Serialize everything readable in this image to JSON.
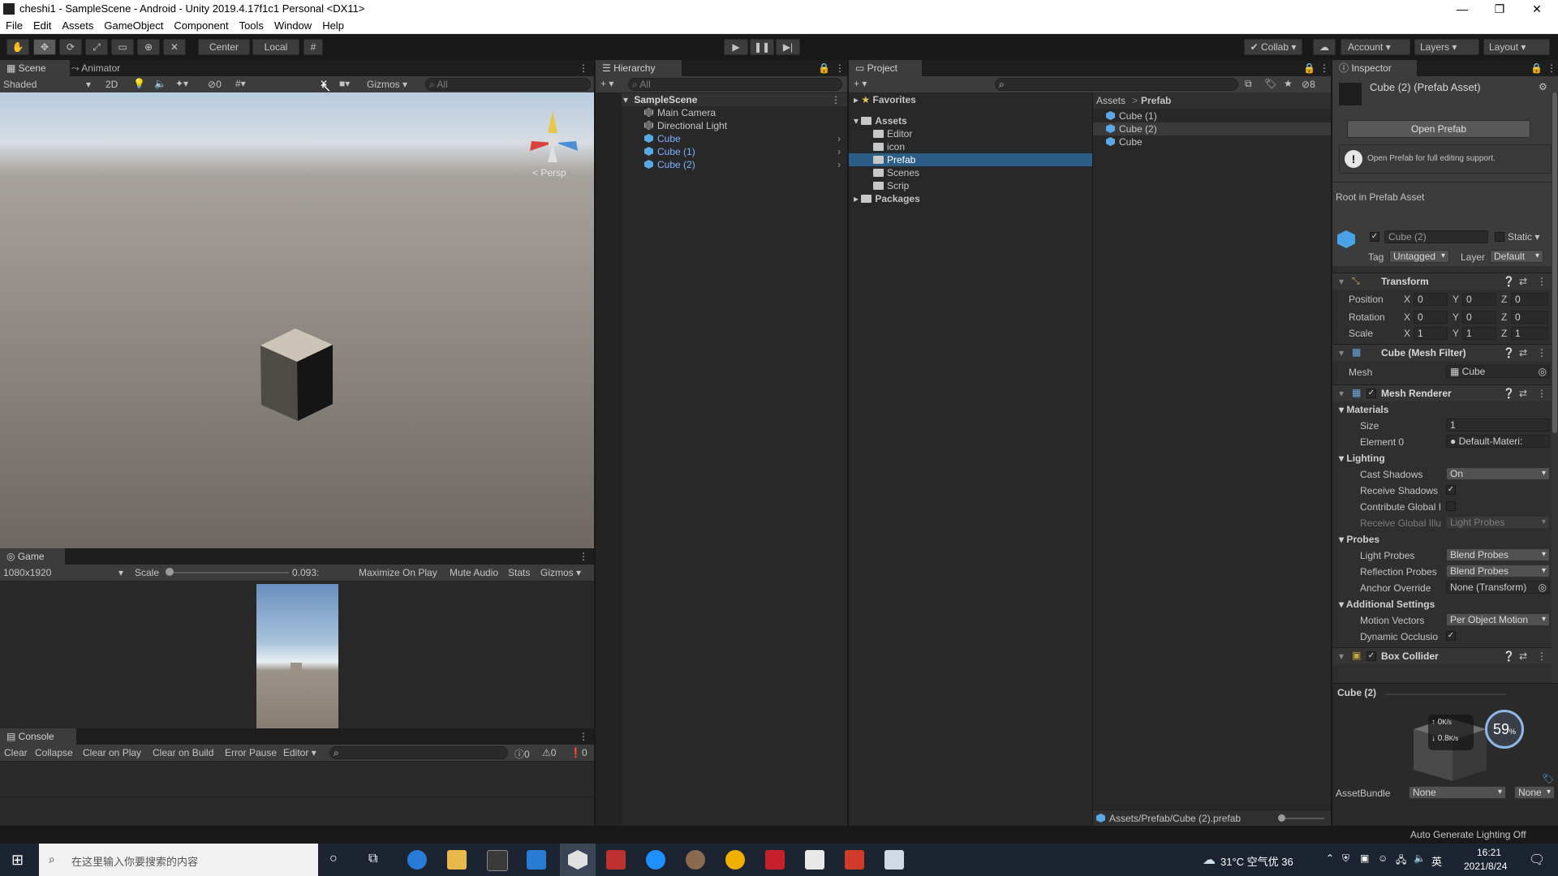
{
  "window": {
    "title": "cheshi1 - SampleScene - Android - Unity 2019.4.17f1c1 Personal <DX11>",
    "minimize": "—",
    "maximize": "❐",
    "close": "✕"
  },
  "menu": [
    "File",
    "Edit",
    "Assets",
    "GameObject",
    "Component",
    "Tools",
    "Window",
    "Help"
  ],
  "toolbar": {
    "center": "Center",
    "local": "Local",
    "collab": "Collab",
    "account": "Account",
    "layers": "Layers",
    "layout": "Layout"
  },
  "scene": {
    "tab_scene": "Scene",
    "tab_animator": "Animator",
    "shading": "Shaded",
    "mode_2d": "2D",
    "hidden_count": "0",
    "gizmos": "Gizmos",
    "search_placeholder": "All",
    "persp": "Persp"
  },
  "game": {
    "tab": "Game",
    "resolution": "1080x1920",
    "scale_label": "Scale",
    "scale_value": "0.093:",
    "maximize": "Maximize On Play",
    "mute": "Mute Audio",
    "stats": "Stats",
    "gizmos": "Gizmos"
  },
  "console": {
    "tab": "Console",
    "clear": "Clear",
    "collapse": "Collapse",
    "clear_on_play": "Clear on Play",
    "clear_on_build": "Clear on Build",
    "error_pause": "Error Pause",
    "editor": "Editor",
    "log_count": "0",
    "warn_count": "0",
    "error_count": "0"
  },
  "hierarchy": {
    "tab": "Hierarchy",
    "search_placeholder": "All",
    "scene": "SampleScene",
    "items": [
      "Main Camera",
      "Directional Light",
      "Cube",
      "Cube (1)",
      "Cube (2)"
    ]
  },
  "project": {
    "tab": "Project",
    "hidden_count": "8",
    "favorites": "Favorites",
    "assets": "Assets",
    "folders": [
      "Editor",
      "icon",
      "Prefab",
      "Scenes",
      "Scrip"
    ],
    "packages": "Packages",
    "breadcrumb_root": "Assets",
    "breadcrumb_sep": ">",
    "breadcrumb_current": "Prefab",
    "files": [
      "Cube (1)",
      "Cube (2)",
      "Cube"
    ],
    "path": "Assets/Prefab/Cube (2).prefab"
  },
  "inspector": {
    "tab": "Inspector",
    "asset_title": "Cube (2) (Prefab Asset)",
    "open_prefab": "Open Prefab",
    "info": "Open Prefab for full editing support.",
    "root_label": "Root in Prefab Asset",
    "object_name": "Cube (2)",
    "static": "Static",
    "tag_label": "Tag",
    "tag_value": "Untagged",
    "layer_label": "Layer",
    "layer_value": "Default",
    "transform": {
      "title": "Transform",
      "position_label": "Position",
      "position": [
        "0",
        "0",
        "0"
      ],
      "rotation_label": "Rotation",
      "rotation": [
        "0",
        "0",
        "0"
      ],
      "scale_label": "Scale",
      "scale": [
        "1",
        "1",
        "1"
      ],
      "axes": [
        "X",
        "Y",
        "Z"
      ]
    },
    "mesh_filter": {
      "title": "Cube (Mesh Filter)",
      "mesh_label": "Mesh",
      "mesh_value": "Cube"
    },
    "mesh_renderer": {
      "title": "Mesh Renderer",
      "materials": "Materials",
      "size_label": "Size",
      "size_value": "1",
      "element0_label": "Element 0",
      "element0_value": "Default-Materi:",
      "lighting": "Lighting",
      "cast_shadows_label": "Cast Shadows",
      "cast_shadows_value": "On",
      "receive_shadows_label": "Receive Shadows",
      "contribute_gi_label": "Contribute Global I",
      "receive_gi_label": "Receive Global Illu",
      "receive_gi_value": "Light Probes",
      "probes": "Probes",
      "light_probes_label": "Light Probes",
      "light_probes_value": "Blend Probes",
      "reflection_probes_label": "Reflection Probes",
      "reflection_probes_value": "Blend Probes",
      "anchor_override_label": "Anchor Override",
      "anchor_override_value": "None (Transform)",
      "additional_settings": "Additional Settings",
      "motion_vectors_label": "Motion Vectors",
      "motion_vectors_value": "Per Object Motion",
      "dynamic_occlusion_label": "Dynamic Occlusio"
    },
    "box_collider": {
      "title": "Box Collider"
    },
    "preview_title": "Cube (2)",
    "net_up": "0",
    "net_up_unit": "K/s",
    "net_down": "0.8",
    "net_down_unit": "K/s",
    "cpu_percent": "59",
    "cpu_unit": "%",
    "assetbundle_label": "AssetBundle",
    "assetbundle_value": "None",
    "assetbundle_variant": "None"
  },
  "status": {
    "right": "Auto Generate Lighting Off"
  },
  "taskbar": {
    "search_placeholder": "在这里输入你要搜索的内容",
    "weather": "31°C 空气优 36",
    "ime": "英",
    "time": "16:21",
    "date": "2021/8/24"
  },
  "colors": {
    "selection": "#2c5d87",
    "prefab_blue": "#7cb3ff",
    "panel_bg": "#282828",
    "taskbar_bg": "#1c2431"
  }
}
